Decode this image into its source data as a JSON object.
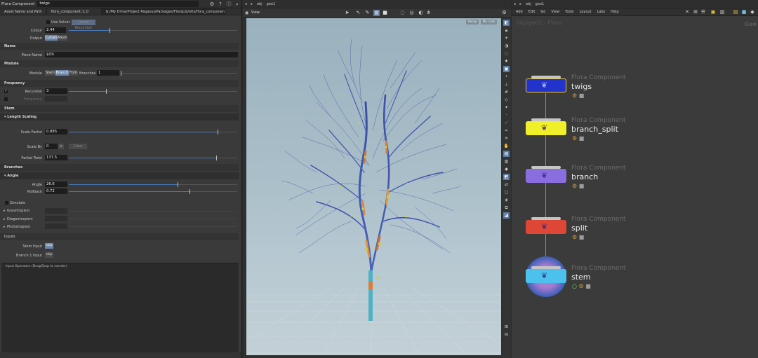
{
  "param_pane": {
    "node_type": "Flora Component",
    "node_name": "twigs",
    "tabs": [
      "Asset Name and Path",
      "flora_component::1.0",
      "G:/My Drive/Project Pegasus/Packages/FloraLib/otls/flora_component.1.0.hda"
    ],
    "use_solver": "Use Solver",
    "reset_recursion": "Reset Recursion",
    "colour_label": "Colour",
    "colour_value": "2.44",
    "output_label": "Output",
    "output_options": [
      "Curves",
      "Mesh"
    ],
    "name_section": "Name",
    "piece_name_label": "Piece Name",
    "piece_name_value": "$OS",
    "module_section": "Module",
    "module_label": "Module",
    "module_options": [
      "Stem",
      "Branch",
      "Fork"
    ],
    "branches_label": "Branches",
    "branches_value": "1",
    "frequency_section": "Frequency",
    "recursion_label": "Recursion",
    "recursion_value": "3",
    "frequency_label": "Frequency",
    "stem_section": "Stem",
    "length_scaling_section": "Length Scaling",
    "scale_factor_label": "Scale Factor",
    "scale_factor_value": "0.885",
    "scale_by_label": "Scale By",
    "scale_by_value": "0",
    "clear_label": "Clear",
    "partial_twist_label": "Partial Twist",
    "partial_twist_value": "137.5",
    "branches_section": "Branches",
    "angle_section": "Angle",
    "angle_label": "Angle",
    "angle_value": "26.6",
    "rollback_label": "Rollback",
    "rollback_value": "0.72",
    "simulate_label": "Simulate",
    "gravitropism_label": "Gravitropism",
    "diageotropism_label": "Diageotropism",
    "phototropism_label": "Phototropism",
    "inputs_section": "Inputs",
    "stem_input_label": "Stem Input",
    "stem_input_value": "skip",
    "branch_input_label": "Branch 1 Input",
    "branch_input_value": "skip",
    "input_operators": "Input Operators (Drag/Drop to reorder)"
  },
  "viewport": {
    "crumb_obj": "obj",
    "crumb_geo": "geo1",
    "view_label": "View",
    "persp_chip": "Persp",
    "nocam_chip": "No cam"
  },
  "network": {
    "crumb_obj": "obj",
    "crumb_geo": "geo1",
    "menu": [
      "Add",
      "Edit",
      "Go",
      "View",
      "Tools",
      "Layout",
      "Labs",
      "Help"
    ],
    "path_watermark": "/obj/geo1 - Flora",
    "context_watermark": "Geo",
    "nodes": [
      {
        "type": "Flora Component",
        "name": "twigs",
        "color": "#2233cc"
      },
      {
        "type": "Flora Component",
        "name": "branch_split",
        "color": "#f0ef2a"
      },
      {
        "type": "Flora Component",
        "name": "branch",
        "color": "#8a6ee0"
      },
      {
        "type": "Flora Component",
        "name": "split",
        "color": "#de4635"
      },
      {
        "type": "Flora Component",
        "name": "stem",
        "color": "#4cc1ee"
      }
    ]
  },
  "colors": {
    "accent": "#5a7ba5",
    "sky_top": "#9ab1be",
    "ground": "#c3d0d6"
  }
}
